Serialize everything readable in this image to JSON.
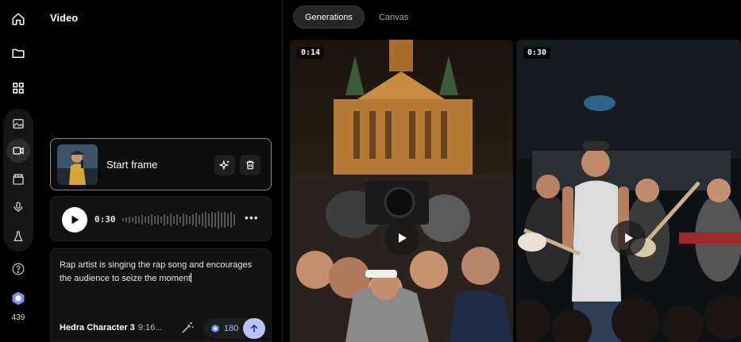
{
  "panel": {
    "title": "Video",
    "start_frame_label": "Start frame",
    "audio_time": "0:30",
    "prompt": "Rap artist is singing the rap song and encourages the audience to seize the moment",
    "model_name": "Hedra Character 3",
    "model_meta": "9:16...",
    "cost": "180"
  },
  "rail": {
    "credits": "439",
    "icons": [
      "home-icon",
      "folder-icon",
      "grid-icon",
      "image-icon",
      "video-icon",
      "clapperboard-icon",
      "microphone-icon",
      "flask-icon",
      "help-icon",
      "credits-icon"
    ]
  },
  "tabs": [
    {
      "label": "Generations",
      "active": true
    },
    {
      "label": "Canvas",
      "active": false
    }
  ],
  "generations": [
    {
      "duration": "0:14"
    },
    {
      "duration": "0:30"
    }
  ],
  "colors": {
    "accent": "#b8c4ff",
    "credit_blue": "#7a8cff",
    "background": "#000000"
  }
}
